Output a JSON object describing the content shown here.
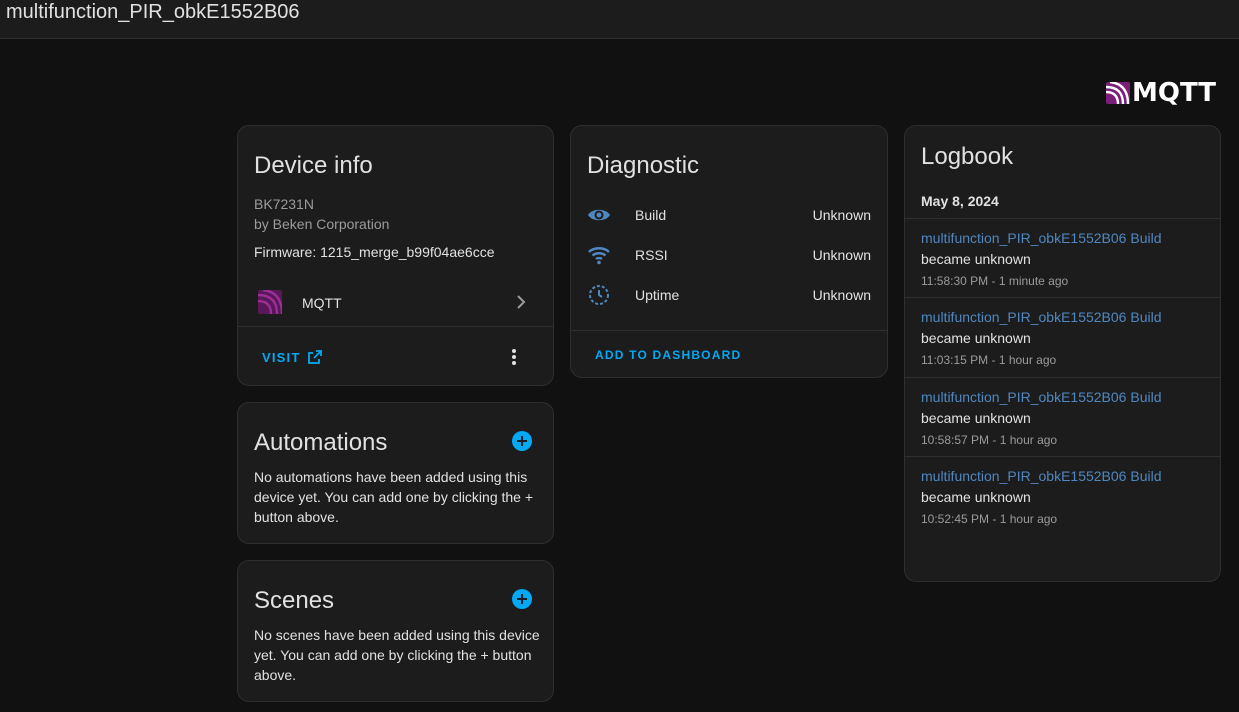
{
  "header": {
    "title": "multifunction_PIR_obkE1552B06"
  },
  "brand": {
    "logo_text": "MQTT",
    "logo_color": "#7b1e7a"
  },
  "device_info": {
    "title": "Device info",
    "model": "BK7231N",
    "manufacturer": "by Beken Corporation",
    "firmware": "Firmware: 1215_merge_b99f04ae6cce",
    "integration": {
      "label": "MQTT",
      "icon": "mqtt-icon"
    },
    "visit_label": "Visit",
    "menu_icon": "dots-vertical-icon"
  },
  "automations": {
    "title": "Automations",
    "text": "No automations have been added using this device yet. You can add one by clicking the + button above."
  },
  "scenes": {
    "title": "Scenes",
    "text": "No scenes have been added using this device yet. You can add one by clicking the + button above."
  },
  "diagnostic": {
    "title": "Diagnostic",
    "rows": [
      {
        "icon": "eye-icon",
        "name": "Build",
        "value": "Unknown"
      },
      {
        "icon": "wifi-icon",
        "name": "RSSI",
        "value": "Unknown"
      },
      {
        "icon": "timer-icon",
        "name": "Uptime",
        "value": "Unknown"
      }
    ],
    "add_label": "Add to dashboard"
  },
  "logbook": {
    "title": "Logbook",
    "date": "May 8, 2024",
    "entries": [
      {
        "entity": "multifunction_PIR_obkE1552B06 Build",
        "message": "became unknown",
        "time": "11:58:30 PM - 1 minute ago"
      },
      {
        "entity": "multifunction_PIR_obkE1552B06 Build",
        "message": "became unknown",
        "time": "11:03:15 PM - 1 hour ago"
      },
      {
        "entity": "multifunction_PIR_obkE1552B06 Build",
        "message": "became unknown",
        "time": "10:58:57 PM - 1 hour ago"
      },
      {
        "entity": "multifunction_PIR_obkE1552B06 Build",
        "message": "became unknown",
        "time": "10:52:45 PM - 1 hour ago"
      }
    ]
  },
  "colors": {
    "accent": "#03a9f4",
    "link": "#4f87c0",
    "card": "#1c1c1c",
    "background": "#111111"
  }
}
